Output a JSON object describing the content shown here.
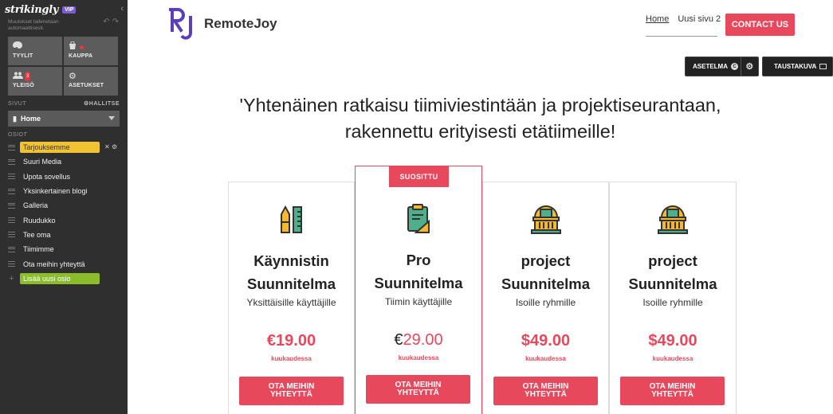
{
  "sidebar": {
    "brand": "strikingly",
    "vip_badge": "VIP",
    "autosave_note": "Muutokset tallenetaan automaattisesti.",
    "tiles": [
      {
        "label": "TYYLIT",
        "icon": "palette-icon"
      },
      {
        "label": "KAUPPA",
        "icon": "shopping-bag-icon"
      },
      {
        "label": "YLEISÖ",
        "icon": "people-icon",
        "badge": "3"
      },
      {
        "label": "ASETUKSET",
        "icon": "gear-icon"
      }
    ],
    "pages_label": "SIVUT",
    "manage_label": "HALLITSE",
    "current_page": "Home",
    "sections_label": "OSIOT",
    "sections": [
      "Tarjouksemme",
      "Suuri Media",
      "Upota sovellus",
      "Yksinkertainen blogi",
      "Galleria",
      "Ruudukko",
      "Tee oma",
      "Tiimimme",
      "Ota meihin yhteyttä"
    ],
    "add_section_label": "Lisää uusi osio",
    "colors": {
      "active": "#f1c232",
      "add": "#8bbd2b",
      "badge": "#e8373e"
    }
  },
  "header": {
    "logo_mark": "RJ",
    "logo_text": "RemoteJoy",
    "nav": [
      "Home",
      "Uusi sivu 2"
    ],
    "contact_label": "CONTACT US"
  },
  "toolbar": {
    "layout_label": "ASETELMA",
    "layout_badge": "C",
    "background_label": "TAUSTAKUVA"
  },
  "main": {
    "headline_line1": "'Yhtenäinen ratkaisu tiimiviestintään ja projektiseurantaan,",
    "headline_line2": "rakennettu erityisesti etätiimeille!",
    "popular_label": "SUOSITTU",
    "plans": [
      {
        "title1": "Käynnistin",
        "title2": "Suunnitelma",
        "subtitle": "Yksittäisille käyttäjille",
        "price": "€19.00",
        "period": "kuukaudessa",
        "cta": "OTA MEIHIN YHTEYTTÄ",
        "icon": "pen-ruler-icon"
      },
      {
        "title1": "Pro",
        "title2": "Suunnitelma",
        "subtitle": "Tiimin käyttäjille",
        "price_currency": "€",
        "price_amount": "29.00",
        "period": "kuukaudessa",
        "cta": "OTA MEIHIN YHTEYTTÄ",
        "icon": "clipboard-icon"
      },
      {
        "title1": "project",
        "title2": "Suunnitelma",
        "subtitle": "Isoille ryhmille",
        "price": "$49.00",
        "period": "kuukaudessa",
        "cta": "OTA MEIHIN YHTEYTTÄ",
        "icon": "building-icon"
      },
      {
        "title1": "project",
        "title2": "Suunnitelma",
        "subtitle": "Isoille ryhmille",
        "price": "$49.00",
        "period": "kuukaudessa",
        "cta": "OTA MEIHIN YHTEYTTÄ",
        "icon": "building-icon"
      }
    ],
    "colors": {
      "accent": "#e8485c",
      "brand": "#5b3fb8"
    }
  }
}
